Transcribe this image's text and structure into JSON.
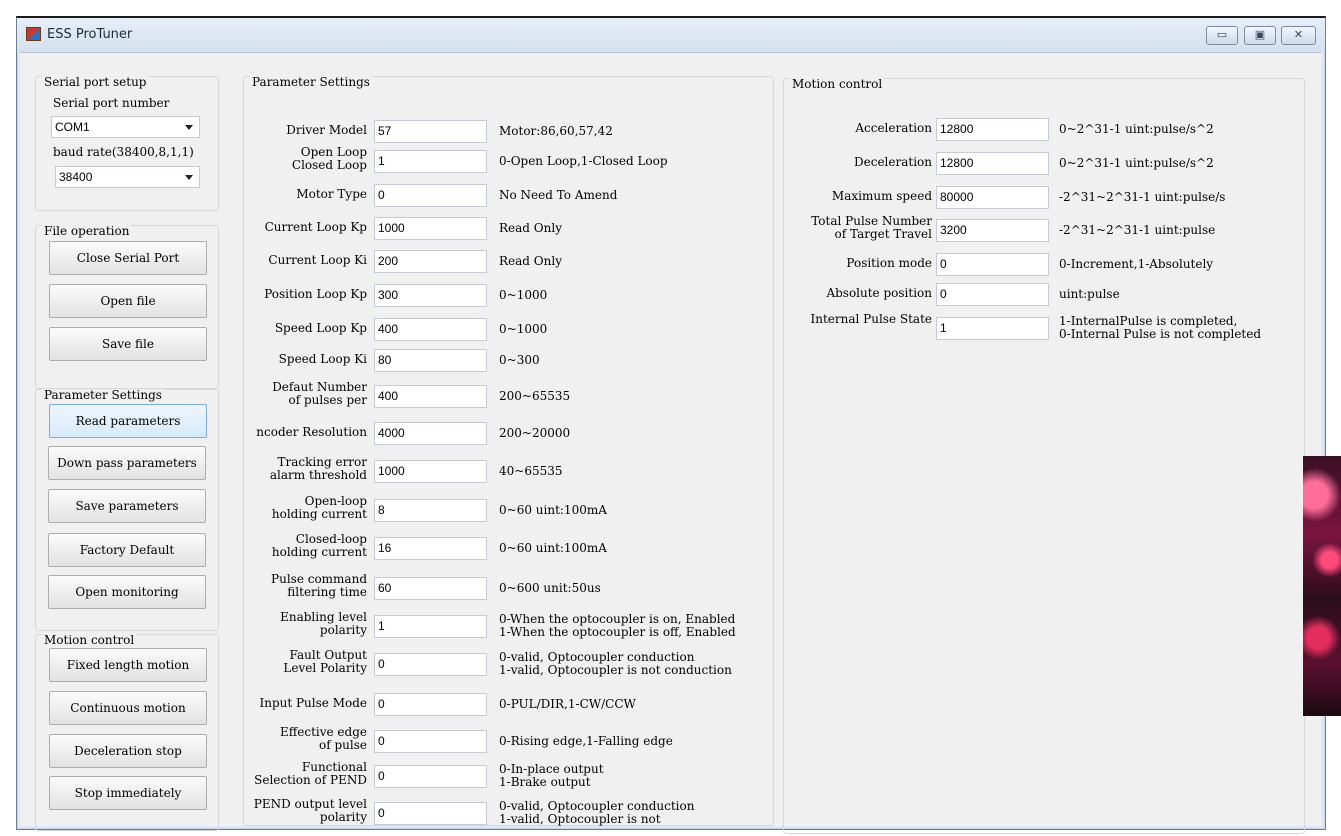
{
  "window": {
    "title": "ESS ProTuner",
    "controls": {
      "minimize": "▭",
      "maximize": "▣",
      "close": "✕"
    }
  },
  "serial": {
    "group_title": "Serial port setup",
    "port_label": "Serial port number",
    "port_value": "COM1",
    "baud_label": "baud rate(38400,8,1,1)",
    "baud_value": "38400"
  },
  "file_op": {
    "group_title": "File operation",
    "buttons": [
      "Close Serial Port",
      "Open file",
      "Save file"
    ]
  },
  "param_btns": {
    "group_title": "Parameter Settings",
    "buttons": [
      "Read parameters",
      "Down pass parameters",
      "Save parameters",
      "Factory Default",
      "Open monitoring"
    ]
  },
  "motion_btns": {
    "group_title": "Motion control",
    "buttons": [
      "Fixed length motion",
      "Continuous motion",
      "Deceleration stop",
      "Stop immediately"
    ]
  },
  "params": {
    "group_title": "Parameter Settings",
    "rows": [
      {
        "label": "Driver Model",
        "value": "57",
        "hint": "Motor:86,60,57,42"
      },
      {
        "label": "Open Loop\nClosed Loop",
        "value": "1",
        "hint": "0-Open Loop,1-Closed Loop"
      },
      {
        "label": "Motor Type",
        "value": "0",
        "hint": "No Need To Amend"
      },
      {
        "label": "Current Loop Kp",
        "value": "1000",
        "hint": "Read Only"
      },
      {
        "label": "Current Loop Ki",
        "value": "200",
        "hint": "Read Only"
      },
      {
        "label": "Position Loop Kp",
        "value": "300",
        "hint": "0~1000"
      },
      {
        "label": "Speed Loop Kp",
        "value": "400",
        "hint": "0~1000"
      },
      {
        "label": "Speed Loop Ki",
        "value": "80",
        "hint": "0~300"
      },
      {
        "label": "Defaut Number\nof pulses per",
        "value": "400",
        "hint": "200~65535"
      },
      {
        "label": "ncoder Resolution",
        "value": "4000",
        "hint": "200~20000"
      },
      {
        "label": "Tracking error\nalarm threshold",
        "value": "1000",
        "hint": "40~65535"
      },
      {
        "label": "Open-loop\nholding current",
        "value": "8",
        "hint": "0~60 uint:100mA"
      },
      {
        "label": "Closed-loop\nholding current",
        "value": "16",
        "hint": "0~60 uint:100mA"
      },
      {
        "label": "Pulse command\nfiltering time",
        "value": "60",
        "hint": "0~600 unit:50us"
      },
      {
        "label": "Enabling level\npolarity",
        "value": "1",
        "hint": "0-When the optocoupler is on, Enabled\n1-When the optocoupler is off, Enabled"
      },
      {
        "label": "Fault Output\nLevel Polarity",
        "value": "0",
        "hint": "0-valid, Optocoupler conduction\n1-valid, Optocoupler is not conduction"
      },
      {
        "label": "Input Pulse Mode",
        "value": "0",
        "hint": "0-PUL/DIR,1-CW/CCW"
      },
      {
        "label": "Effective edge\nof pulse",
        "value": "0",
        "hint": "0-Rising edge,1-Falling edge"
      },
      {
        "label": "Functional\nSelection of PEND",
        "value": "0",
        "hint": "0-In-place output\n1-Brake output"
      },
      {
        "label": "PEND output level\npolarity",
        "value": "0",
        "hint": "0-valid, Optocoupler conduction\n1-valid, Optocoupler is not"
      }
    ]
  },
  "motion": {
    "group_title": "Motion control",
    "rows": [
      {
        "label": "Acceleration",
        "value": "12800",
        "hint": "0~2^31-1 uint:pulse/s^2"
      },
      {
        "label": "Deceleration",
        "value": "12800",
        "hint": "0~2^31-1 uint:pulse/s^2"
      },
      {
        "label": "Maximum speed",
        "value": "80000",
        "hint": "-2^31~2^31-1 uint:pulse/s"
      },
      {
        "label": "Total Pulse Number\nof Target Travel",
        "value": "3200",
        "hint": "-2^31~2^31-1 uint:pulse"
      },
      {
        "label": "Position mode",
        "value": "0",
        "hint": "0-Increment,1-Absolutely"
      },
      {
        "label": "Absolute position",
        "value": "0",
        "hint": "uint:pulse"
      },
      {
        "label": "Internal Pulse State",
        "value": "1",
        "hint": "1-InternalPulse is completed,\n0-Internal Pulse is not completed"
      }
    ]
  }
}
